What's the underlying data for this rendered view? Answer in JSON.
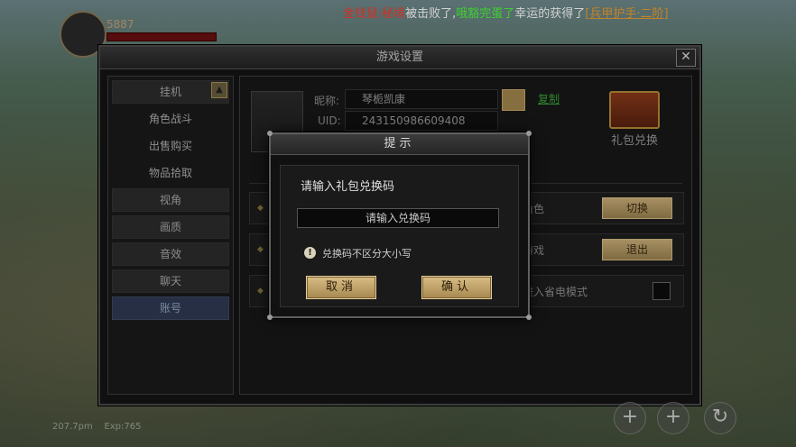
{
  "ticker": {
    "part1": "金钱鼠·秘境",
    "part2": "被击败了,",
    "part3": "哦豁完蛋了",
    "part4": "幸运的获得了",
    "part5": "[兵甲护手·二阶]"
  },
  "hud": {
    "level": "5887",
    "exp": "Exp:765",
    "coords": "207.7pm"
  },
  "window": {
    "title": "游戏设置",
    "close": "✕",
    "sidebar": [
      {
        "label": "挂机",
        "kind": "cat"
      },
      {
        "label": "角色战斗",
        "kind": "sub"
      },
      {
        "label": "出售购买",
        "kind": "sub"
      },
      {
        "label": "物品拾取",
        "kind": "sub"
      },
      {
        "label": "视角",
        "kind": "cat"
      },
      {
        "label": "画质",
        "kind": "cat"
      },
      {
        "label": "音效",
        "kind": "cat"
      },
      {
        "label": "聊天",
        "kind": "cat"
      },
      {
        "label": "账号",
        "kind": "active"
      }
    ],
    "account": {
      "nickname_label": "昵称:",
      "nickname": "琴栀凯康",
      "uid_label": "UID:",
      "uid": "243150986609408",
      "copy": "复制",
      "gift_label": "礼包兑换",
      "rows": [
        {
          "label": "角色",
          "button": "切换"
        },
        {
          "label": "游戏",
          "button": "退出"
        },
        {
          "label": "进入省电模式",
          "button": ""
        }
      ]
    }
  },
  "dialog": {
    "title": "提示",
    "prompt": "请输入礼包兑换码",
    "placeholder": "请输入兑换码",
    "hint": "兑换码不区分大小写",
    "cancel": "取消",
    "confirm": "确认"
  }
}
